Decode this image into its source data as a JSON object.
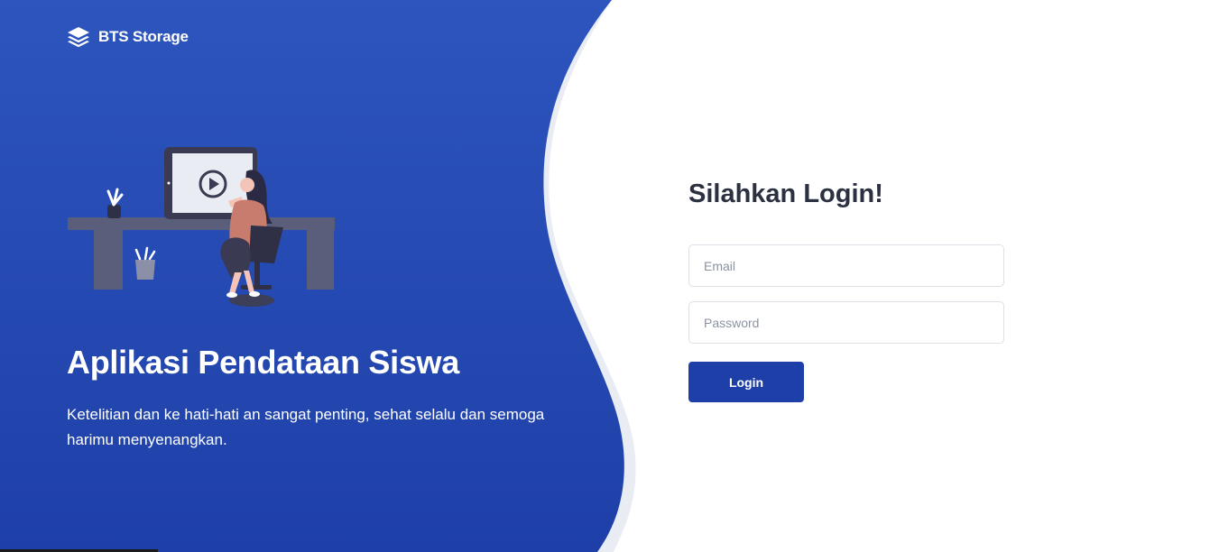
{
  "brand": {
    "name": "BTS Storage",
    "icon": "layers-icon"
  },
  "hero": {
    "title": "Aplikasi Pendataan Siswa",
    "description": "Ketelitian dan ke hati-hati an sangat penting, sehat selalu dan semoga harimu menyenangkan."
  },
  "login": {
    "title": "Silahkan Login!",
    "email_placeholder": "Email",
    "password_placeholder": "Password",
    "button_label": "Login"
  },
  "colors": {
    "hero_gradient_top": "#2d55bd",
    "hero_gradient_bottom": "#1e3fa8",
    "accent": "#1f3fa8",
    "title_text": "#2b3140"
  }
}
